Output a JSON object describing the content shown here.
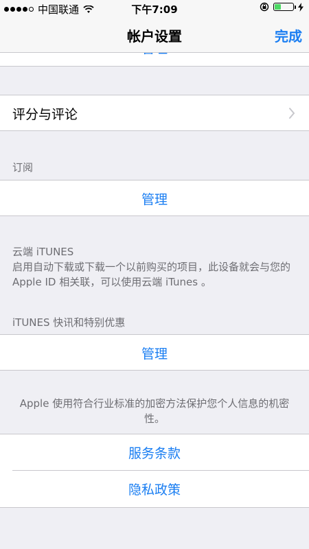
{
  "status_bar": {
    "carrier": "中国联通",
    "time": "下午7:09",
    "battery_level": 0.35,
    "colors": {
      "battery": "#4cd964"
    },
    "icons": [
      "signal-dots",
      "wifi-icon",
      "rotation-lock-icon",
      "battery-icon",
      "charging-icon"
    ]
  },
  "nav": {
    "title": "帐户设置",
    "done_label": "完成",
    "accent_color": "#1a7ef2"
  },
  "clipped_row": {
    "label": "管理"
  },
  "ratings": {
    "label": "评分与评论"
  },
  "subscriptions": {
    "header": "订阅",
    "manage_label": "管理"
  },
  "itunes_cloud": {
    "header": "云端 iTUNES",
    "description": "启用自动下载或下载一个以前购买的项目，此设备就会与您的 Apple ID 相关联，可以使用云端 iTunes 。"
  },
  "itunes_news": {
    "header": "iTUNES 快讯和特别优惠",
    "manage_label": "管理"
  },
  "privacy": {
    "footer": "Apple 使用符合行业标准的加密方法保护您个人信息的机密性。",
    "terms_label": "服务条款",
    "privacy_label": "隐私政策"
  }
}
